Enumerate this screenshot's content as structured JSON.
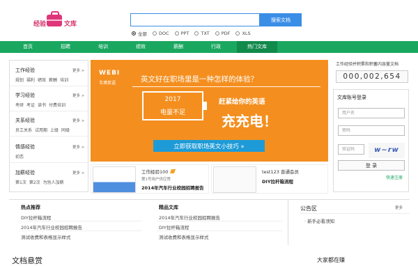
{
  "header": {
    "logo_left": "经验",
    "logo_right": "文库",
    "search_placeholder": "",
    "search_button": "搜索文档",
    "filters": [
      {
        "label": "全部",
        "selected": true
      },
      {
        "label": "DOC",
        "selected": false
      },
      {
        "label": "PPT",
        "selected": false
      },
      {
        "label": "TXT",
        "selected": false
      },
      {
        "label": "PDF",
        "selected": false
      },
      {
        "label": "XLS",
        "selected": false
      }
    ]
  },
  "nav": {
    "items": [
      "首页",
      "招聘",
      "培训",
      "绩效",
      "薪酬",
      "行政",
      "热门文库"
    ],
    "active_index": 6
  },
  "sidebar": {
    "more_label": "更多 >",
    "categories": [
      {
        "title": "工作经验",
        "links": [
          "规划",
          "福利",
          "绩效",
          "薪酬",
          "培训"
        ]
      },
      {
        "title": "学习经验",
        "links": [
          "考研",
          "考证",
          "读书",
          "付费培训"
        ]
      },
      {
        "title": "关系经验",
        "links": [
          "员工关系",
          "试用期",
          "上级",
          "同级"
        ]
      },
      {
        "title": "情感经验",
        "links": [
          "初恋"
        ]
      },
      {
        "title": "加薪经验",
        "links": [
          "第1次",
          "第2次",
          "为别人加薪"
        ]
      }
    ]
  },
  "banner": {
    "logo": "WEBI",
    "logo_sub": "韦博英语",
    "headline": "英文好在职场里是一种怎样的体验？",
    "battery_year": "2017",
    "battery_label": "电量不足",
    "sub": "赶紧给你的英语",
    "big": "充充电！",
    "cta": "立即获取职场英文小技巧 »"
  },
  "cards": [
    {
      "user": "工作经验100",
      "meta": "第1号用户供应赞",
      "title": "2014年汽车行业校园招聘报告"
    },
    {
      "user": "test123  普通会员",
      "meta": "",
      "title": "DIY拉杆箱流程"
    }
  ],
  "right": {
    "stat_label": "工作经验并积累和积蓄内容量文档",
    "counter": "000,002,654",
    "login_title": "文库账号登录",
    "username_placeholder": "用户名",
    "password_placeholder": "密码",
    "captcha_placeholder": "验证码",
    "captcha_text": "w~rw",
    "login_button": "登 录",
    "quick_register": "快速注册"
  },
  "lists": {
    "hot_title": "热点推荐",
    "hot_items": [
      "DIY拉杆箱流程",
      "2014年汽车行业校园招聘报告",
      "测试收费和表格显示样式"
    ],
    "featured_title": "精品文库",
    "featured_items": [
      "2014年汽车行业校园招聘报告",
      "DIY拉杆箱流程",
      "测试收费和表格显示样式"
    ],
    "announce_title": "公告区",
    "announce_more": "更多",
    "announce_items": [
      "新手必看须知"
    ]
  },
  "footer": {
    "bounty_title": "文档悬赏",
    "right_title": "大家都在赚"
  }
}
